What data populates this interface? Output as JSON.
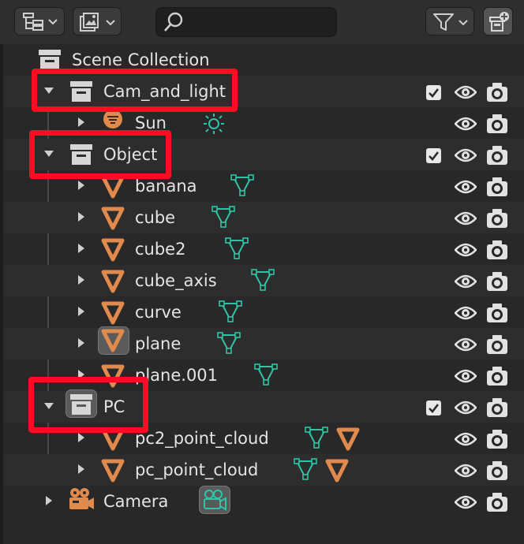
{
  "header": {
    "display_mode_icon": "outliner-tree-icon",
    "filter_icon": "filter-funnel-icon",
    "new_collection_icon": "new-collection-icon",
    "view_layer_icon": "image-stack-icon",
    "search": {
      "value": "",
      "placeholder": ""
    }
  },
  "tree": {
    "scene_collection": {
      "label": "Scene Collection"
    },
    "cam_and_light": {
      "label": "Cam_and_light"
    },
    "sun": {
      "label": "Sun"
    },
    "object": {
      "label": "Object"
    },
    "banana": {
      "label": "banana"
    },
    "cube": {
      "label": "cube"
    },
    "cube2": {
      "label": "cube2"
    },
    "cube_axis": {
      "label": "cube_axis"
    },
    "curve": {
      "label": "curve"
    },
    "plane": {
      "label": "plane"
    },
    "plane001": {
      "label": "plane.001"
    },
    "pc": {
      "label": "PC"
    },
    "pc2_point_cloud": {
      "label": "pc2_point_cloud"
    },
    "pc_point_cloud": {
      "label": "pc_point_cloud"
    },
    "camera": {
      "label": "Camera"
    }
  },
  "colors": {
    "highlight": "#ff0b24",
    "object_orange": "#e08a4d",
    "mesh_data_teal": "#2fc4a6",
    "background": "#282828"
  }
}
